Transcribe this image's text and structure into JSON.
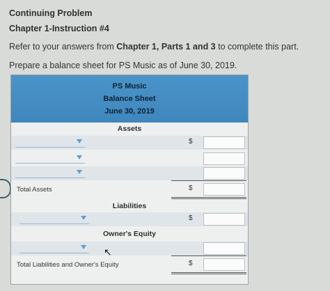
{
  "header": {
    "problem": "Continuing Problem",
    "chapter": "Chapter 1-Instruction #4"
  },
  "instructions": {
    "line1_prefix": "Refer to your answers from ",
    "line1_bold": "Chapter 1, Parts 1 and 3",
    "line1_suffix": " to complete this part.",
    "line2": "Prepare a balance sheet for PS Music as of June 30, 2019."
  },
  "sheet": {
    "company": "PS Music",
    "statement": "Balance Sheet",
    "date": "June 30, 2019",
    "assets_title": "Assets",
    "total_assets_label": "Total Assets",
    "liabilities_title": "Liabilities",
    "equity_title": "Owner's Equity",
    "total_liab_equity_label": "Total Liabilities and Owner's Equity",
    "currency_symbol": "$"
  }
}
